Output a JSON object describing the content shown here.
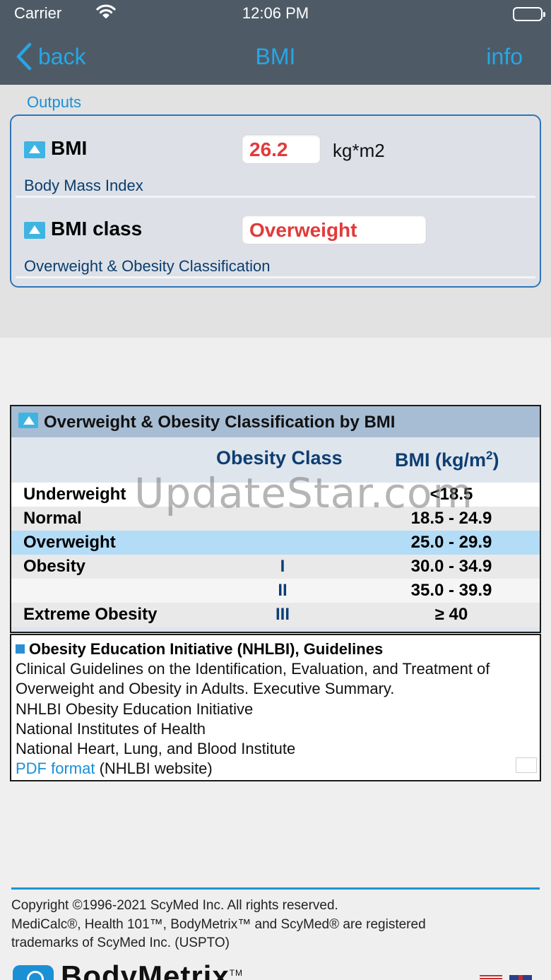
{
  "status_bar": {
    "carrier": "Carrier",
    "time": "12:06 PM"
  },
  "nav": {
    "back": "back",
    "title": "BMI",
    "info": "info"
  },
  "outputs": {
    "label": "Outputs",
    "items": [
      {
        "name": "BMI",
        "value": "26.2",
        "unit": "kg*m2",
        "description": "Body Mass Index"
      },
      {
        "name": "BMI class",
        "value": "Overweight",
        "description": "Overweight & Obesity Classification"
      }
    ]
  },
  "classification": {
    "title": "Overweight & Obesity Classification by BMI",
    "headers": {
      "obesity_class": "Obesity Class",
      "bmi": "BMI (kg/m",
      "bmi_sup": "2",
      "bmi_close": ")"
    },
    "rows": [
      {
        "category": "Underweight",
        "class": "",
        "bmi": "<18.5",
        "highlight": false,
        "bg": "#ffffff"
      },
      {
        "category": "Normal",
        "class": "",
        "bmi": "18.5 - 24.9",
        "highlight": false,
        "bg": "#e9e9e9"
      },
      {
        "category": "Overweight",
        "class": "",
        "bmi": "25.0 - 29.9",
        "highlight": true,
        "bg": "#b3dcf7"
      },
      {
        "category": "Obesity",
        "class": "I",
        "bmi": "30.0 - 34.9",
        "highlight": false,
        "bg": "#e9e9e9"
      },
      {
        "category": "",
        "class": "II",
        "bmi": "35.0 - 39.9",
        "highlight": false,
        "bg": "#f5f5f5"
      },
      {
        "category": "Extreme Obesity",
        "class": "III",
        "bmi": "≥ 40",
        "highlight": false,
        "bg": "#e9e9e9"
      }
    ]
  },
  "reference": {
    "title": "Obesity Education Initiative (NHLBI), Guidelines",
    "lines": [
      "Clinical Guidelines on the Identification, Evaluation, and Treatment of",
      "Overweight and Obesity in Adults. Executive Summary.",
      "NHLBI Obesity Education Initiative",
      "National Institutes of Health",
      "National Heart, Lung, and Blood Institute"
    ],
    "link_text": "PDF format",
    "link_suffix": " (NHLBI website)"
  },
  "footer": {
    "copyright": "Copyright ©1996-2021 ScyMed Inc. All rights reserved.",
    "trademarks_1": "MediCalc®, Health 101™, BodyMetrix™ and ScyMed® are registered",
    "trademarks_2": "trademarks of ScyMed Inc. (USPTO)",
    "brand": "BodyMetrix",
    "brand_tm": "TM"
  },
  "watermark": "UpdateStar.com",
  "colors": {
    "accent": "#25a7e8",
    "value_red": "#e23a3a",
    "navy": "#0d3e73"
  }
}
